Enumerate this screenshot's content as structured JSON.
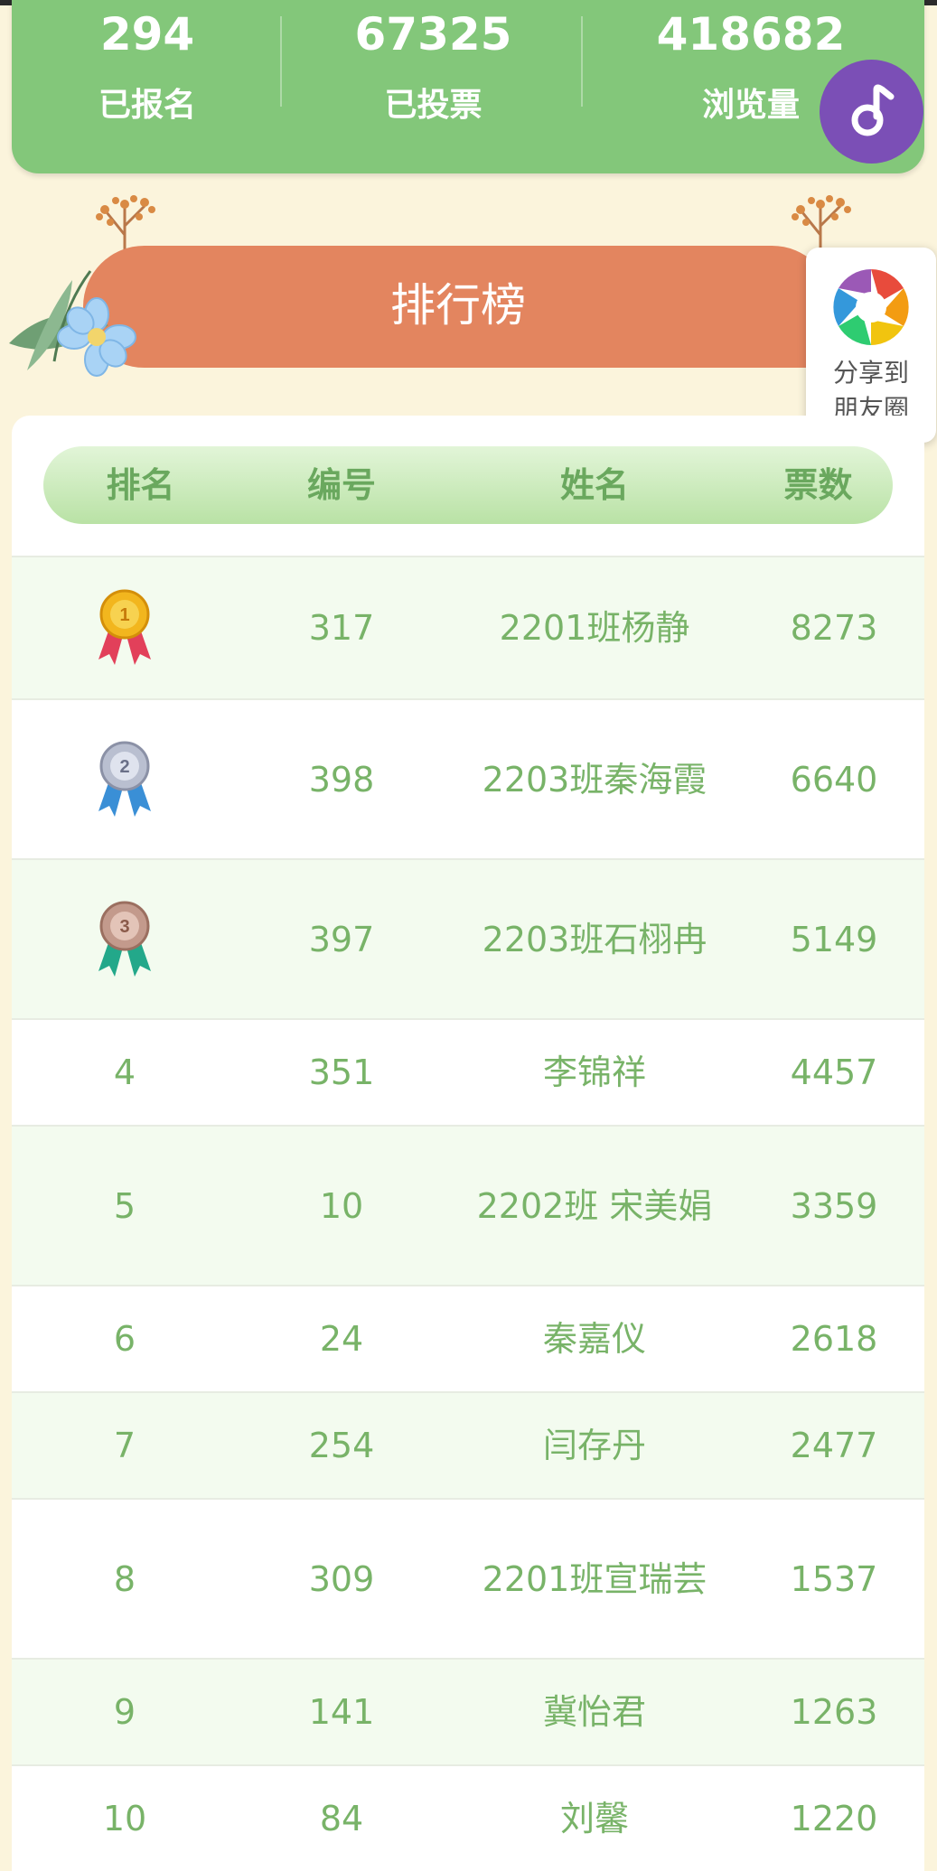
{
  "stats": [
    {
      "value": "294",
      "label": "已报名"
    },
    {
      "value": "67325",
      "label": "已投票"
    },
    {
      "value": "418682",
      "label": "浏览量"
    }
  ],
  "music_button": {
    "icon": "music-note-icon"
  },
  "ranking_title": "排行榜",
  "share": {
    "line1": "分享到",
    "line2": "朋友圈",
    "icon": "aperture-icon"
  },
  "table": {
    "headers": [
      "排名",
      "编号",
      "姓名",
      "票数"
    ],
    "rows": [
      {
        "rank": "1",
        "medal": "gold",
        "id": "317",
        "name": "2201班杨静",
        "votes": "8273"
      },
      {
        "rank": "2",
        "medal": "silver",
        "id": "398",
        "name": "2203班秦海霞",
        "votes": "6640"
      },
      {
        "rank": "3",
        "medal": "bronze",
        "id": "397",
        "name": "2203班石栩冉",
        "votes": "5149"
      },
      {
        "rank": "4",
        "id": "351",
        "name": "李锦祥",
        "votes": "4457"
      },
      {
        "rank": "5",
        "id": "10",
        "name": "2202班 宋美娟",
        "votes": "3359"
      },
      {
        "rank": "6",
        "id": "24",
        "name": "秦嘉仪",
        "votes": "2618"
      },
      {
        "rank": "7",
        "id": "254",
        "name": "闫存丹",
        "votes": "2477"
      },
      {
        "rank": "8",
        "id": "309",
        "name": "2201班宣瑞芸",
        "votes": "1537"
      },
      {
        "rank": "9",
        "id": "141",
        "name": "冀怡君",
        "votes": "1263"
      },
      {
        "rank": "10",
        "id": "84",
        "name": "刘馨",
        "votes": "1220"
      }
    ]
  },
  "colors": {
    "background": "#fbf4dc",
    "stats_green": "#83c77a",
    "banner_orange": "#e3855f",
    "table_text": "#78b368",
    "music_purple": "#7b4fb6"
  }
}
